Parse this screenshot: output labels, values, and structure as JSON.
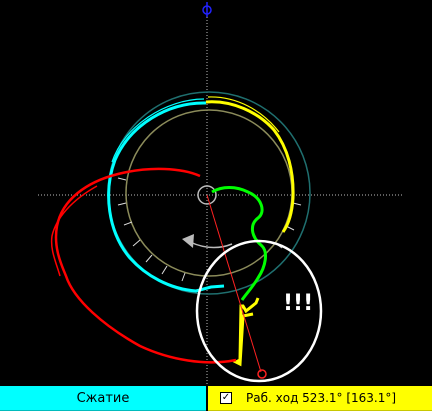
{
  "status_bar": {
    "phase_label": "Сжатие",
    "stroke_checkbox": "✓",
    "stroke_label": "Раб. ход 523.1° [163.1°]"
  },
  "annotation": {
    "exclamation": "!!!"
  },
  "colors": {
    "background": "#000000",
    "compression": "#00ffff",
    "power_stroke": "#ffff00",
    "exhaust": "#ff0000",
    "intake": "#00ff00",
    "reference_circle": "#8b8b5a",
    "outer_circle": "#1f6f6f",
    "crosshair": "#ffffff",
    "highlight_ring": "#ffffff",
    "axis_top_marker": "#2222ff",
    "crank_marker": "#ff2222"
  },
  "icons": {
    "rotation": "rotation-direction-arrow-icon",
    "top_marker": "top-dead-center-marker-icon",
    "crank_end": "crank-end-marker-icon"
  }
}
